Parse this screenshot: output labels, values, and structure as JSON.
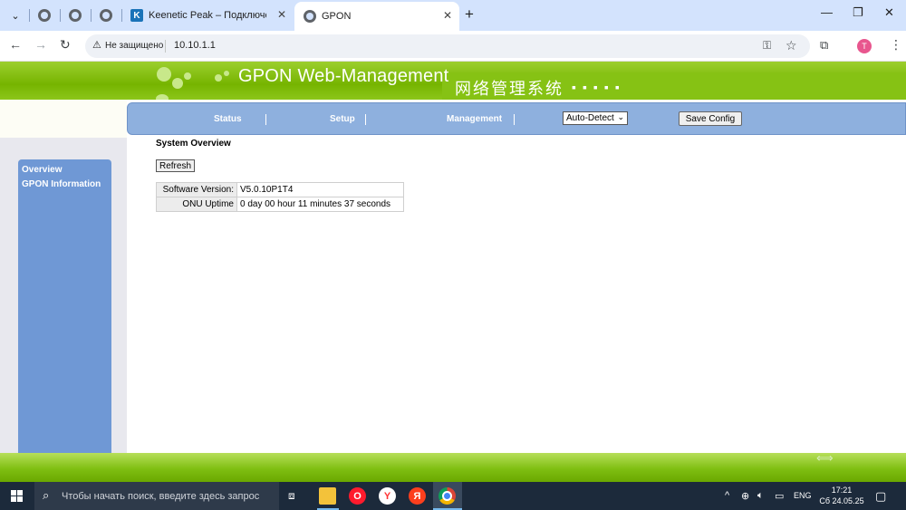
{
  "browser": {
    "tabs": [
      {
        "title": "",
        "icon": "globe-icon"
      },
      {
        "title": "",
        "icon": "globe-icon"
      },
      {
        "title": "",
        "icon": "globe-icon"
      },
      {
        "title": "Keenetic Peak – Подключения",
        "icon": "keenetic-icon"
      },
      {
        "title": "GPON",
        "icon": "globe-icon",
        "active": true
      }
    ],
    "security_label": "Не защищено",
    "url": "10.10.1.1",
    "profile_initial": "T"
  },
  "header": {
    "title": "GPON Web-Management",
    "subtitle_cn": "网络管理系统",
    "dots": "▪▪▪▪▪"
  },
  "nav": {
    "status": "Status",
    "setup": "Setup",
    "management": "Management",
    "language": "Auto-Detect",
    "save_config": "Save Config"
  },
  "sidebar": {
    "items": [
      "Overview",
      "GPON Information"
    ]
  },
  "main": {
    "section_title": "System Overview",
    "refresh_label": "Refresh",
    "rows": [
      {
        "label": "Software Version:",
        "value": "V5.0.10P1T4"
      },
      {
        "label": "ONU Uptime",
        "value": "0 day 00 hour 11 minutes 37 seconds"
      }
    ]
  },
  "taskbar": {
    "search_placeholder": "Чтобы начать поиск, введите здесь запрос",
    "lang": "ENG",
    "time": "17:21",
    "date": "Сб 24.05.25"
  },
  "colors": {
    "header_green": "#76b400",
    "nav_blue": "#8eb0de",
    "sidebar_blue": "#6f98d5",
    "taskbar": "#1c2a3b"
  }
}
